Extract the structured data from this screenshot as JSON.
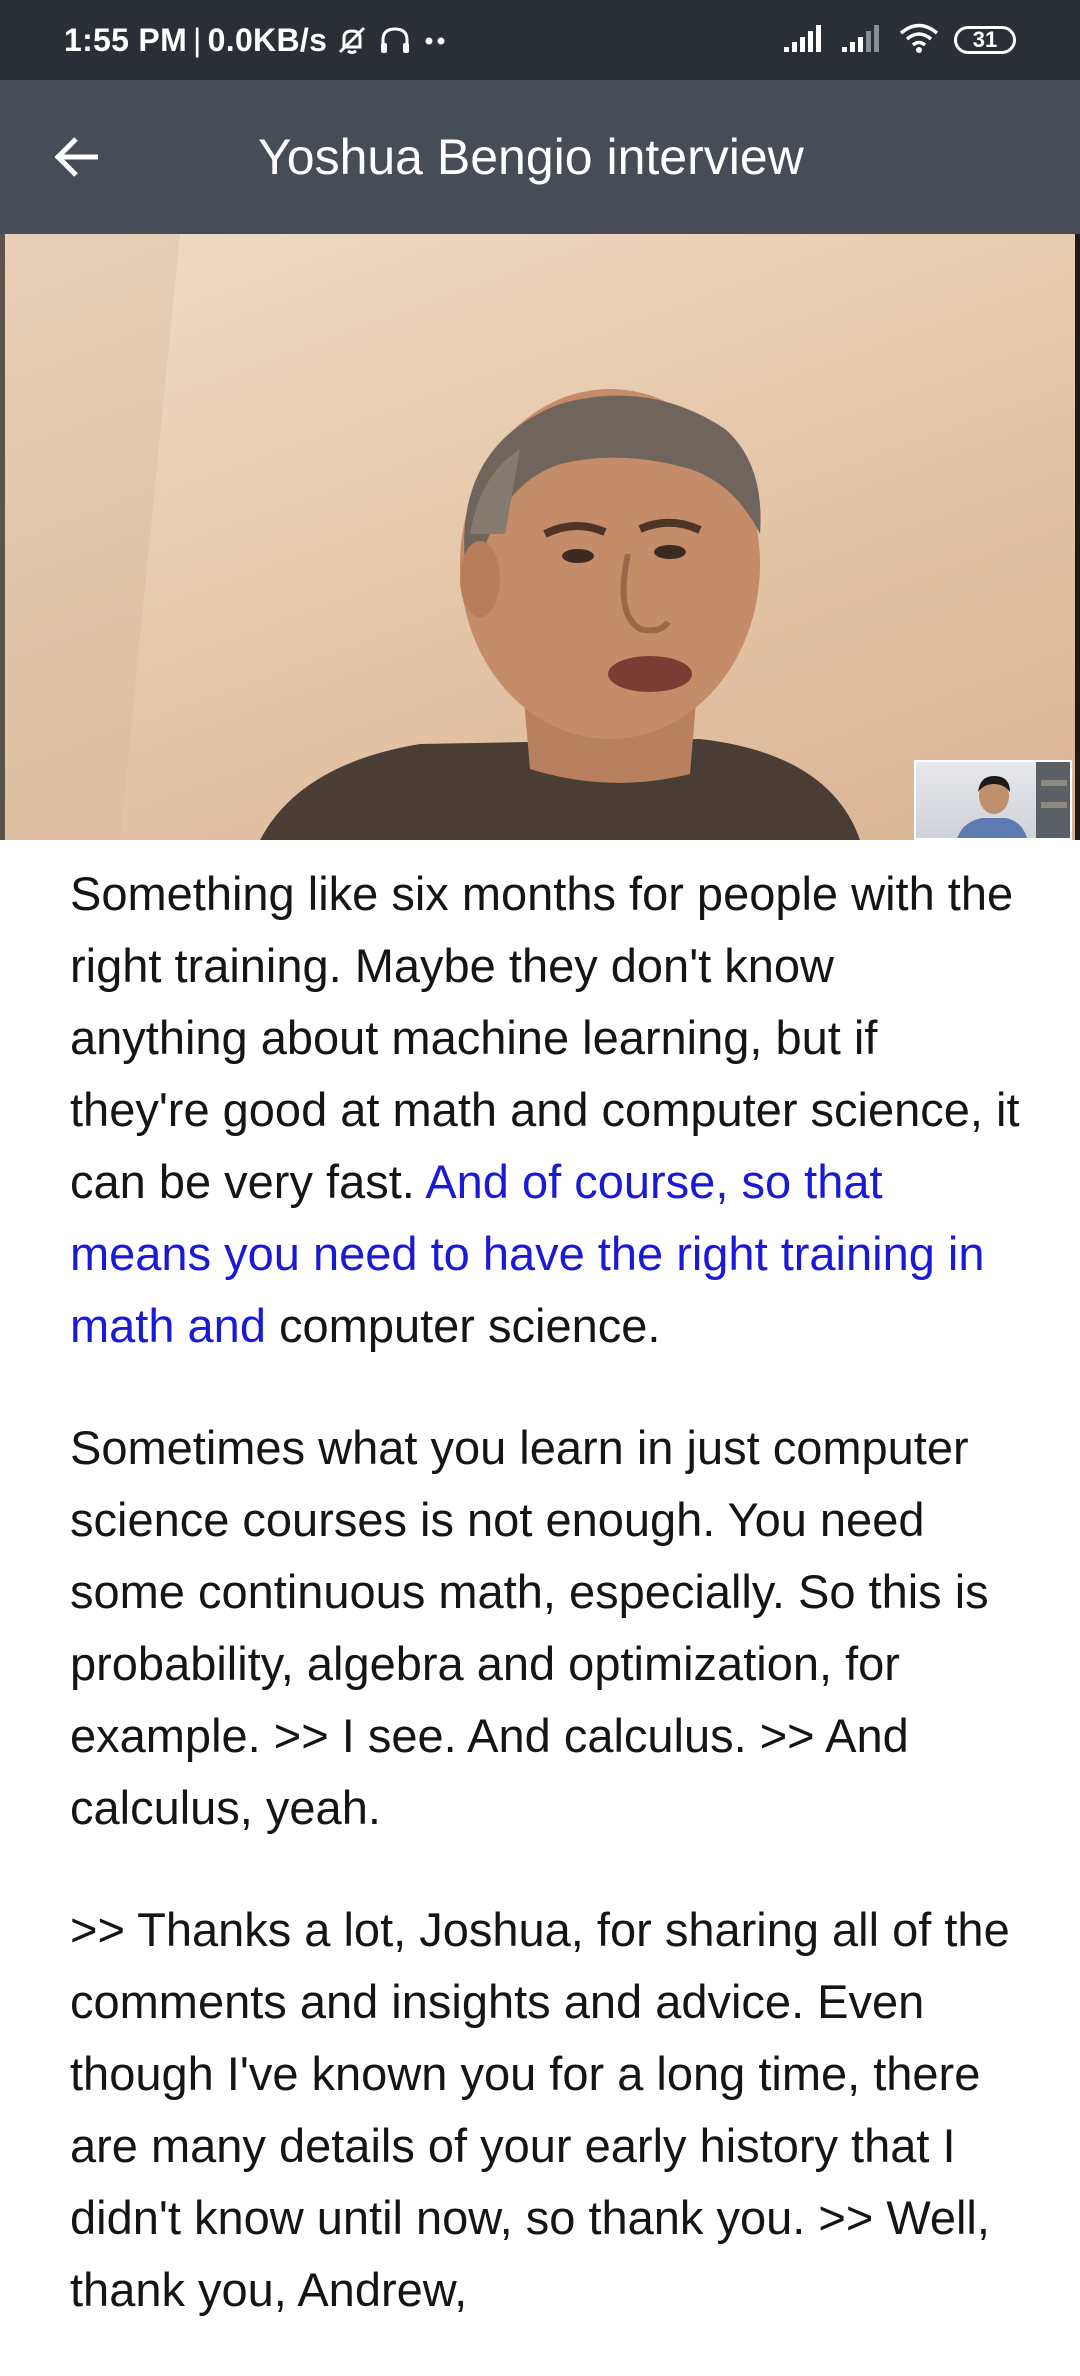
{
  "status_bar": {
    "time": "1:55 PM",
    "separator": "|",
    "network_speed": "0.0KB/s",
    "battery_level": "31",
    "icons": [
      "alarm-off-icon",
      "headphones-icon",
      "more-dots-icon",
      "signal-icon",
      "signal-icon",
      "wifi-icon",
      "battery-icon"
    ]
  },
  "toolbar": {
    "back_icon": "arrow-left-icon",
    "title": "Yoshua Bengio interview"
  },
  "video": {
    "main_feed": "speaker-video",
    "pip_feed": "interviewer-video"
  },
  "transcript": {
    "p1_before": "Something like six months for people with the right training. Maybe they don't know anything about machine learning, but if they're good at math and computer science, it can be very fast. ",
    "p1_highlight": "And of course, so that means you need to have the right training in math and",
    "p1_after": " computer science.",
    "p2": "Sometimes what you learn in just computer science courses is not enough. You need some continuous math, especially. So this is probability, algebra and optimization, for example. >> I see. And calculus. >> And calculus, yeah.",
    "p3": ">> Thanks a lot, Joshua, for sharing all of the comments and insights and advice. Even though I've known you for a long time, there are many details of your early history that I didn't know until now, so thank you. >> Well, thank you, Andrew,"
  },
  "colors": {
    "status_bar_bg": "#2a2f36",
    "toolbar_bg": "#474d57",
    "highlight_text": "#1a1ad6",
    "body_text": "#151515"
  }
}
